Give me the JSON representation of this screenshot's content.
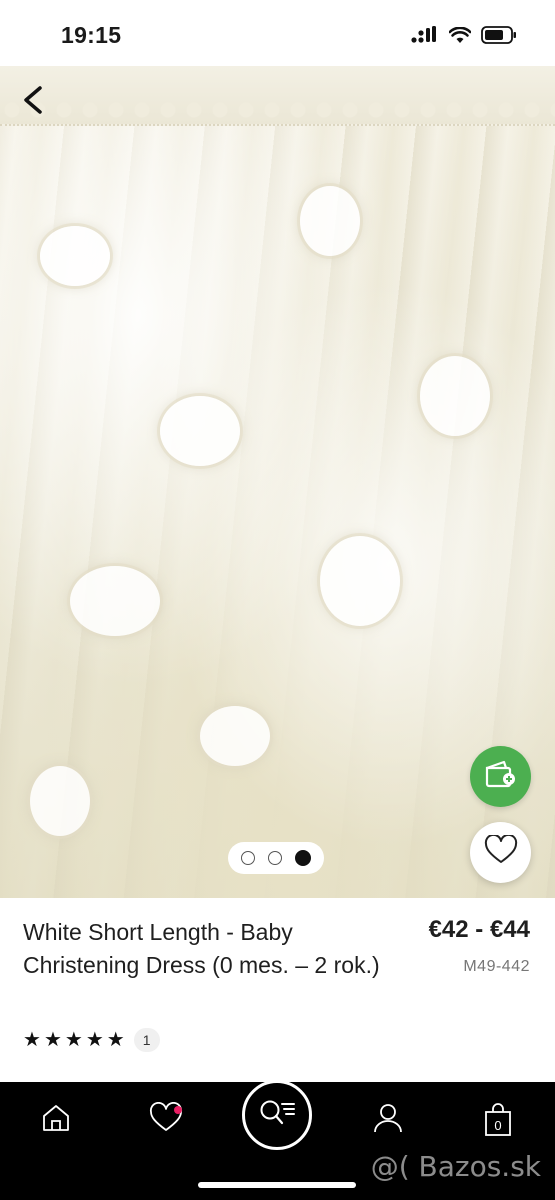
{
  "status_bar": {
    "time": "19:15",
    "icons": [
      "cellular-signal-icon",
      "wifi-icon",
      "battery-icon"
    ]
  },
  "gallery": {
    "back_icon": "chevron-left-icon",
    "image_count": 3,
    "active_index": 2,
    "wallet_button_icon": "wallet-add-icon",
    "favorite_button_icon": "heart-outline-icon"
  },
  "product": {
    "title": "White Short Length - Baby Christening Dress (0 mes. – 2 rok.)",
    "price": "€42 - €44",
    "sku": "M49-442",
    "rating_stars": 5,
    "review_count": "1"
  },
  "bottom_nav": {
    "items": [
      "home-icon",
      "heart-icon",
      "search-menu-icon",
      "user-icon",
      "cart-bag-icon"
    ],
    "cart_count": "0"
  },
  "watermark": "@( Bazos.sk",
  "colors": {
    "accent_green": "#4caf50",
    "nav_background": "#000000",
    "favorite_dot": "#e91e63"
  }
}
